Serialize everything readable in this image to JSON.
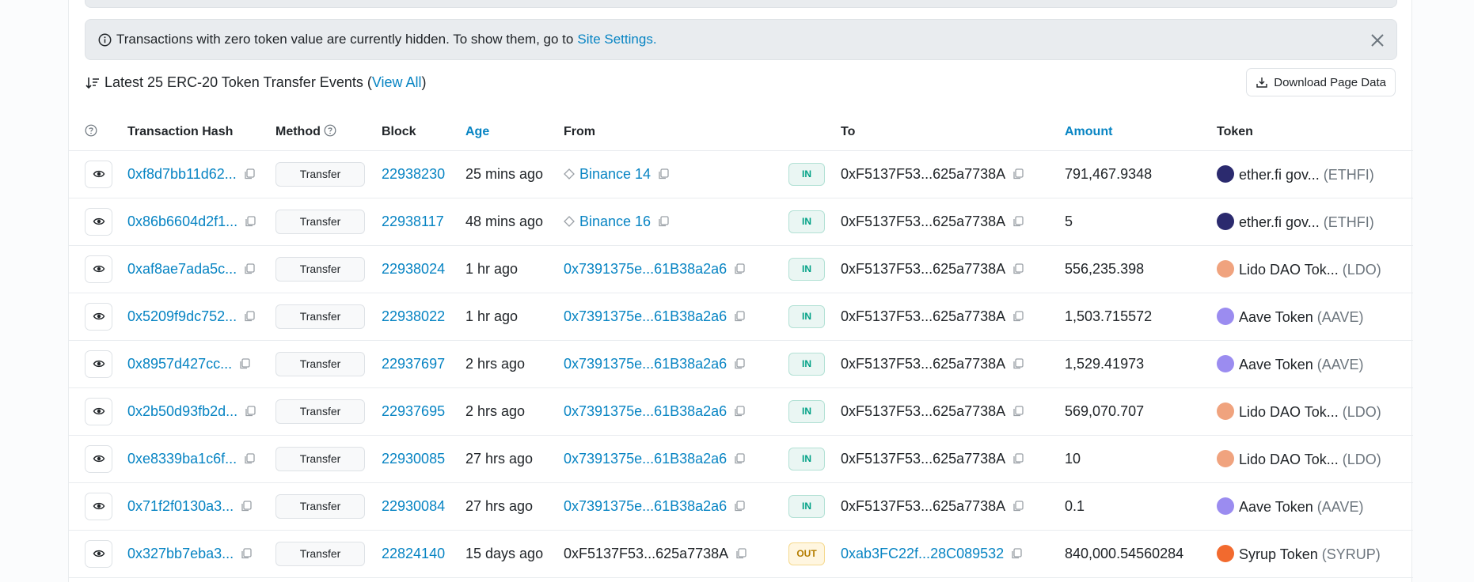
{
  "alert": {
    "text": "Transactions with zero token value are currently hidden. To show them, go to",
    "link": "Site Settings."
  },
  "heading": {
    "prefix": "Latest 25 ERC-20 Token Transfer Events (",
    "link": "View All",
    "suffix": ")"
  },
  "download_label": "Download Page Data",
  "columns": {
    "hash": "Transaction Hash",
    "method": "Method",
    "block": "Block",
    "age": "Age",
    "from": "From",
    "to": "To",
    "amount": "Amount",
    "token": "Token"
  },
  "rows": [
    {
      "hash": "0xf8d7bb11d62...",
      "method": "Transfer",
      "block": "22938230",
      "age": "25 mins ago",
      "from": "Binance 14",
      "from_type": "label",
      "dir": "IN",
      "to": "0xF5137F53...625a7738A",
      "to_type": "self",
      "amount": "791,467.9348",
      "token_name": "ether.fi gov...",
      "token_sym": "(ETHFI)",
      "token_color": "#2b2a6e"
    },
    {
      "hash": "0x86b6604d2f1...",
      "method": "Transfer",
      "block": "22938117",
      "age": "48 mins ago",
      "from": "Binance 16",
      "from_type": "label",
      "dir": "IN",
      "to": "0xF5137F53...625a7738A",
      "to_type": "self",
      "amount": "5",
      "token_name": "ether.fi gov...",
      "token_sym": "(ETHFI)",
      "token_color": "#2b2a6e"
    },
    {
      "hash": "0xaf8ae7ada5c...",
      "method": "Transfer",
      "block": "22938024",
      "age": "1 hr ago",
      "from": "0x7391375e...61B38a2a6",
      "from_type": "address",
      "dir": "IN",
      "to": "0xF5137F53...625a7738A",
      "to_type": "self",
      "amount": "556,235.398",
      "token_name": "Lido DAO Tok...",
      "token_sym": "(LDO)",
      "token_color": "#f0a37e"
    },
    {
      "hash": "0x5209f9dc752...",
      "method": "Transfer",
      "block": "22938022",
      "age": "1 hr ago",
      "from": "0x7391375e...61B38a2a6",
      "from_type": "address",
      "dir": "IN",
      "to": "0xF5137F53...625a7738A",
      "to_type": "self",
      "amount": "1,503.715572",
      "token_name": "Aave Token",
      "token_sym": "(AAVE)",
      "token_color": "#9b8cf0"
    },
    {
      "hash": "0x8957d427cc...",
      "method": "Transfer",
      "block": "22937697",
      "age": "2 hrs ago",
      "from": "0x7391375e...61B38a2a6",
      "from_type": "address",
      "dir": "IN",
      "to": "0xF5137F53...625a7738A",
      "to_type": "self",
      "amount": "1,529.41973",
      "token_name": "Aave Token",
      "token_sym": "(AAVE)",
      "token_color": "#9b8cf0"
    },
    {
      "hash": "0x2b50d93fb2d...",
      "method": "Transfer",
      "block": "22937695",
      "age": "2 hrs ago",
      "from": "0x7391375e...61B38a2a6",
      "from_type": "address",
      "dir": "IN",
      "to": "0xF5137F53...625a7738A",
      "to_type": "self",
      "amount": "569,070.707",
      "token_name": "Lido DAO Tok...",
      "token_sym": "(LDO)",
      "token_color": "#f0a37e"
    },
    {
      "hash": "0xe8339ba1c6f...",
      "method": "Transfer",
      "block": "22930085",
      "age": "27 hrs ago",
      "from": "0x7391375e...61B38a2a6",
      "from_type": "address",
      "dir": "IN",
      "to": "0xF5137F53...625a7738A",
      "to_type": "self",
      "amount": "10",
      "token_name": "Lido DAO Tok...",
      "token_sym": "(LDO)",
      "token_color": "#f0a37e"
    },
    {
      "hash": "0x71f2f0130a3...",
      "method": "Transfer",
      "block": "22930084",
      "age": "27 hrs ago",
      "from": "0x7391375e...61B38a2a6",
      "from_type": "address",
      "dir": "IN",
      "to": "0xF5137F53...625a7738A",
      "to_type": "self",
      "amount": "0.1",
      "token_name": "Aave Token",
      "token_sym": "(AAVE)",
      "token_color": "#9b8cf0"
    },
    {
      "hash": "0x327bb7eba3...",
      "method": "Transfer",
      "block": "22824140",
      "age": "15 days ago",
      "from": "0xF5137F53...625a7738A",
      "from_type": "self",
      "dir": "OUT",
      "to": "0xab3FC22f...28C089532",
      "to_type": "address",
      "amount": "840,000.54560284",
      "token_name": "Syrup Token",
      "token_sym": "(SYRUP)",
      "token_color": "#f26a2e"
    }
  ]
}
